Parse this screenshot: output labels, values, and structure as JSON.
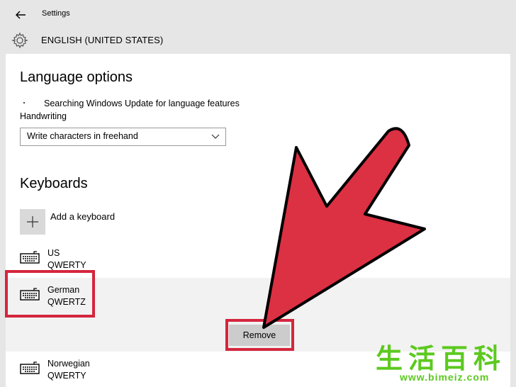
{
  "titlebar": {
    "title": "Settings"
  },
  "header": {
    "title": "ENGLISH (UNITED STATES)"
  },
  "language_options": {
    "heading": "Language options",
    "status": "Searching Windows Update for language features",
    "handwriting_label": "Handwriting",
    "handwriting_value": "Write characters in freehand"
  },
  "keyboards": {
    "heading": "Keyboards",
    "add_label": "Add a keyboard",
    "items": [
      {
        "name": "US",
        "layout": "QWERTY"
      },
      {
        "name": "German",
        "layout": "QWERTZ",
        "selected": true
      },
      {
        "name": "Norwegian",
        "layout": "QWERTY"
      }
    ],
    "remove_label": "Remove"
  },
  "annotation": {
    "highlight_color": "#d4263d",
    "arrow_color": "#e03040"
  },
  "watermark": {
    "chars": [
      "生",
      "活",
      "百",
      "科"
    ],
    "url": "www.bimeiz.com"
  }
}
